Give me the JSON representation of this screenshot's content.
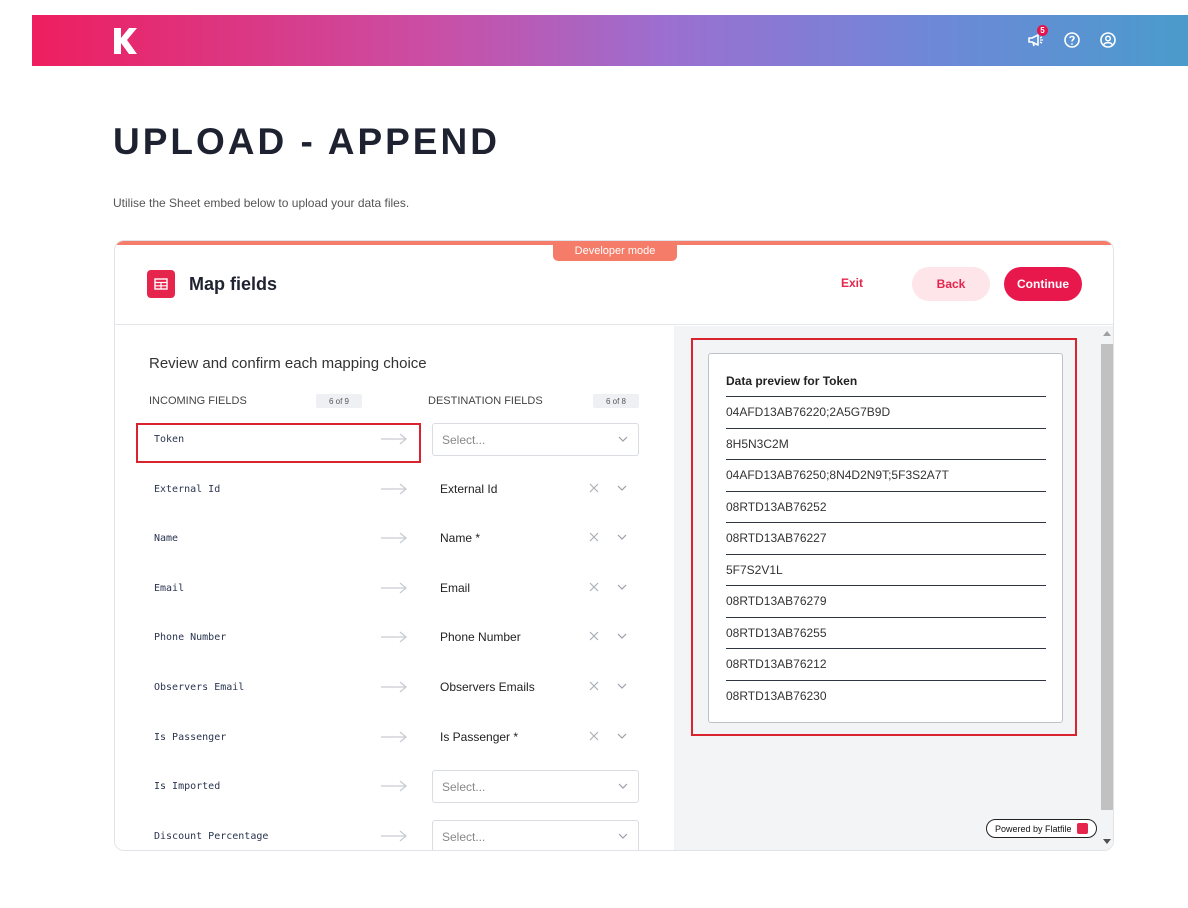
{
  "topbar": {
    "notification_count": "5",
    "icons": [
      "logo-icon",
      "megaphone-icon",
      "help-icon",
      "account-icon"
    ]
  },
  "page": {
    "title": "UPLOAD - APPEND",
    "subtitle": "Utilise the Sheet embed below to upload your data files."
  },
  "card": {
    "dev_mode_label": "Developer mode",
    "title": "Map fields",
    "exit_label": "Exit",
    "back_label": "Back",
    "continue_label": "Continue"
  },
  "mapping": {
    "heading": "Review and confirm each mapping choice",
    "incoming_header": "INCOMING FIELDS",
    "incoming_count": "6 of 9",
    "destination_header": "DESTINATION FIELDS",
    "destination_count": "6 of 8",
    "select_placeholder": "Select...",
    "rows": [
      {
        "incoming": "Token",
        "destination": null
      },
      {
        "incoming": "External Id",
        "destination": "External Id"
      },
      {
        "incoming": "Name",
        "destination": "Name *"
      },
      {
        "incoming": "Email",
        "destination": "Email"
      },
      {
        "incoming": "Phone Number",
        "destination": "Phone Number"
      },
      {
        "incoming": "Observers Email",
        "destination": "Observers Emails"
      },
      {
        "incoming": "Is Passenger",
        "destination": "Is Passenger *"
      },
      {
        "incoming": "Is Imported",
        "destination": null
      },
      {
        "incoming": "Discount Percentage",
        "destination": null
      }
    ]
  },
  "preview": {
    "title": "Data preview for Token",
    "values": [
      "04AFD13AB76220;2A5G7B9D",
      "8H5N3C2M",
      "04AFD13AB76250;8N4D2N9T;5F3S2A7T",
      "08RTD13AB76252",
      "08RTD13AB76227",
      "5F7S2V1L",
      "08RTD13AB76279",
      "08RTD13AB76255",
      "08RTD13AB76212",
      "08RTD13AB76230"
    ]
  },
  "footer": {
    "powered_by": "Powered by Flatfile"
  },
  "colors": {
    "accent": "#e8174c",
    "dev_mode": "#f47c68",
    "highlight": "#d9232e"
  }
}
